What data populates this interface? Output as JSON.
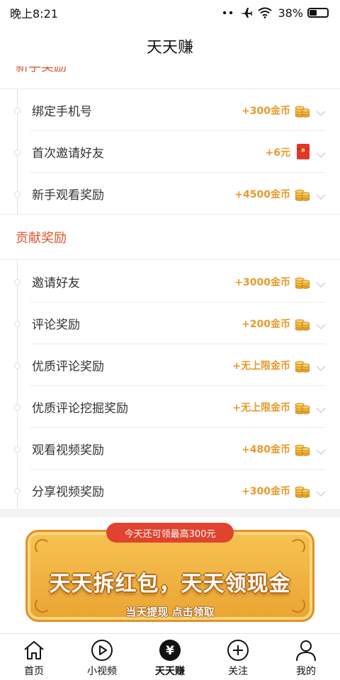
{
  "status_bar": {
    "time": "晚上8:21",
    "battery": "38%",
    "battery_level": 0.38
  },
  "header": {
    "title": "天天赚"
  },
  "sections": {
    "newbie": {
      "title": "新手奖励",
      "items": [
        {
          "label": "绑定手机号",
          "reward": "+300金币",
          "icon": "gold-coins-icon"
        },
        {
          "label": "首次邀请好友",
          "reward": "+6元",
          "icon": "red-envelope-icon"
        },
        {
          "label": "新手观看奖励",
          "reward": "+4500金币",
          "icon": "gold-coins-icon"
        }
      ]
    },
    "contribution": {
      "title": "贡献奖励",
      "items": [
        {
          "label": "邀请好友",
          "reward": "+3000金币",
          "icon": "gold-coins-icon"
        },
        {
          "label": "评论奖励",
          "reward": "+200金币",
          "icon": "gold-coins-icon"
        },
        {
          "label": "优质评论奖励",
          "reward": "+无上限金币",
          "icon": "gold-coins-icon"
        },
        {
          "label": "优质评论挖掘奖励",
          "reward": "+无上限金币",
          "icon": "gold-coins-icon"
        },
        {
          "label": "观看视频奖励",
          "reward": "+480金币",
          "icon": "gold-coins-icon"
        },
        {
          "label": "分享视频奖励",
          "reward": "+300金币",
          "icon": "gold-coins-icon"
        }
      ]
    }
  },
  "banner": {
    "pill": "今天还可领最高300元",
    "title": "天天拆红包，天天领现金",
    "subtitle": "当天提现 点击领取"
  },
  "tabs": [
    {
      "label": "首页",
      "icon": "home-icon"
    },
    {
      "label": "小视频",
      "icon": "play-circle-icon"
    },
    {
      "label": "天天赚",
      "icon": "yen-circle-icon",
      "active": true
    },
    {
      "label": "关注",
      "icon": "plus-circle-icon"
    },
    {
      "label": "我的",
      "icon": "person-icon"
    }
  ],
  "colors": {
    "accent_red": "#e0542f",
    "reward_gold": "#e79a2b",
    "banner_gold": "#f6c353"
  }
}
